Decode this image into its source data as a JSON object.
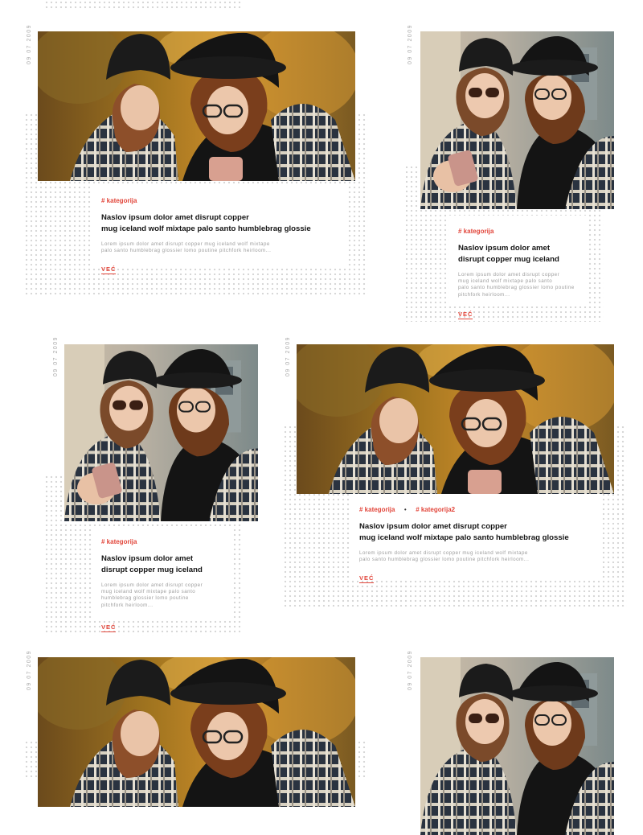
{
  "cards": [
    {
      "date": "09 07 2009",
      "categories": [
        "# kategorija"
      ],
      "title_line1": "Naslov ipsum dolor amet disrupt copper",
      "title_line2": "mug iceland wolf mixtape palo santo humblebrag glossie",
      "excerpt_line1": "Lorem ipsum dolor amet disrupt copper mug iceland wolf mixtape",
      "excerpt_line2": "palo santo humblebrag glossier lomo poutine pitchfork heirloom...",
      "excerpt_line3": "",
      "excerpt_line4": "",
      "more_label": "VEĆ"
    },
    {
      "date": "09 07 2009",
      "categories": [
        "# kategorija"
      ],
      "title_line1": "Naslov ipsum dolor amet",
      "title_line2": "disrupt copper mug iceland",
      "excerpt_line1": "Lorem ipsum dolor amet disrupt copper",
      "excerpt_line2": "mug iceland wolf mixtape palo santo",
      "excerpt_line3": "palo santo humblebrag glossier lomo poutine",
      "excerpt_line4": "pitchfork heirloom...",
      "more_label": "VEĆ"
    },
    {
      "date": "09 07 2009",
      "categories": [
        "# kategorija"
      ],
      "title_line1": "Naslov ipsum dolor amet",
      "title_line2": "disrupt copper mug iceland",
      "excerpt_line1": "Lorem ipsum dolor amet disrupt copper",
      "excerpt_line2": "mug iceland wolf mixtape palo santo",
      "excerpt_line3": "humblebrag glossier lomo poutine",
      "excerpt_line4": "pitchfork heirloom...",
      "more_label": "VEĆ"
    },
    {
      "date": "09 07 2009",
      "categories": [
        "# kategorija",
        "# kategorija2"
      ],
      "title_line1": "Naslov ipsum dolor amet disrupt copper",
      "title_line2": "mug iceland wolf mixtape palo santo humblebrag glossie",
      "excerpt_line1": "Lorem ipsum dolor amet disrupt copper mug iceland wolf mixtape",
      "excerpt_line2": "palo santo humblebrag glossier lomo poutine pitchfork heirloom...",
      "excerpt_line3": "",
      "excerpt_line4": "",
      "more_label": "VEĆ"
    },
    {
      "date": "09 07 2009"
    },
    {
      "date": "09 07 2009"
    }
  ],
  "category_separator": "•",
  "colors": {
    "accent": "#e2463b",
    "title": "#141414",
    "excerpt": "#9d9d9d",
    "dots": "#d3d3d3"
  }
}
